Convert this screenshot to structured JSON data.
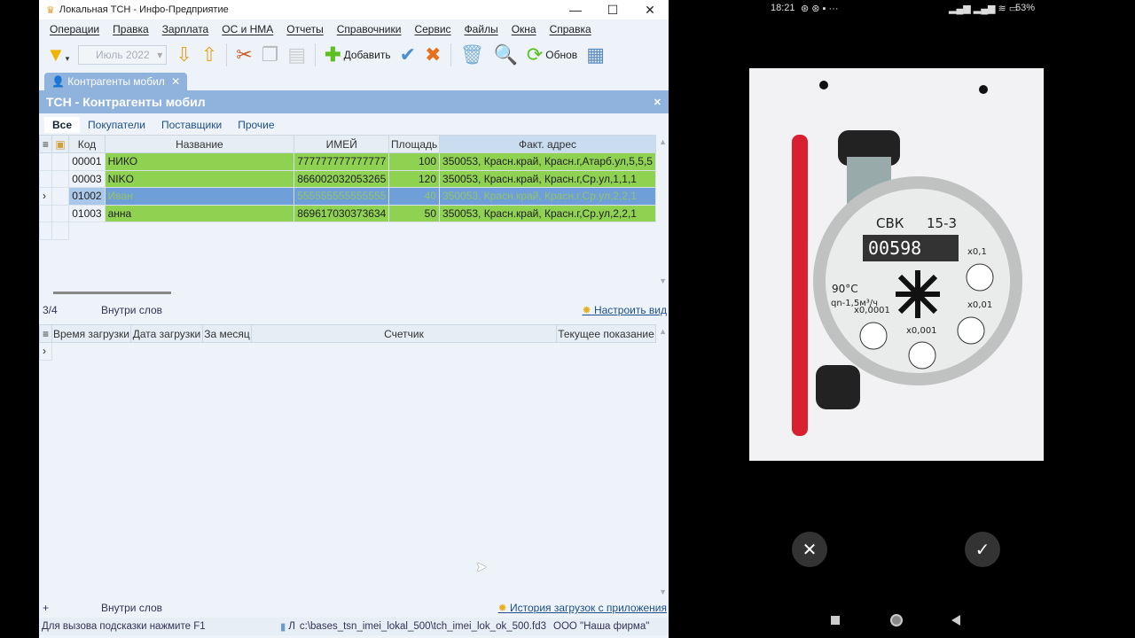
{
  "window": {
    "title": "Локальная ТСН - Инфо-Предприятие",
    "min": "—",
    "max": "☐",
    "close": "✕"
  },
  "menu": [
    "Операции",
    "Правка",
    "Зарплата",
    "ОС и НМА",
    "Отчеты",
    "Справочники",
    "Сервис",
    "Файлы",
    "Окна",
    "Справка"
  ],
  "toolbar": {
    "month": "Июль 2022",
    "add": "Добавить",
    "refresh": "Обнов"
  },
  "tab": {
    "label": "Контрагенты мобил",
    "close": "✕"
  },
  "panel": {
    "title": "ТСН - Контрагенты мобил",
    "close": "✕"
  },
  "subtabs": [
    "Все",
    "Покупатели",
    "Поставщики",
    "Прочие"
  ],
  "grid": {
    "columns": [
      "Код",
      "Название",
      "ИМЕЙ",
      "Площадь",
      "Факт. адрес"
    ],
    "rows": [
      {
        "code": "00001",
        "name": "НИКО",
        "imei": "777777777777777",
        "area": "100",
        "addr": "350053, Красн.край, Красн.г,Атарб.ул,5,5,5"
      },
      {
        "code": "00003",
        "name": "NIKO",
        "imei": "866002032053265",
        "area": "120",
        "addr": "350053, Красн.край, Красн.г,Ср.ул,1,1,1"
      },
      {
        "code": "01002",
        "name": "Иван",
        "imei": "555555555555555",
        "area": "40",
        "addr": "350053, Красн.край, Красн.г,Ср.ул,2,2,1"
      },
      {
        "code": "01003",
        "name": "анна",
        "imei": "869617030373634",
        "area": "50",
        "addr": "350053, Красн.край, Красн.г,Ср.ул,2,2,1"
      }
    ]
  },
  "status1": {
    "count": "3/4",
    "mode": "Внутри слов",
    "link": "Настроить вид"
  },
  "grid2": {
    "columns": [
      "Время загрузки",
      "Дата загрузки",
      "За месяц",
      "Счетчик",
      "Текущее показание"
    ]
  },
  "status2": {
    "plus": "+",
    "mode": "Внутри слов",
    "link": "История загрузок с приложения"
  },
  "bottom": {
    "hint": "Для вызова подсказки нажмите F1",
    "lang": "Л",
    "path": "c:\\bases_tsn_imei_lokal_500\\tch_imei_lok_ok_500.fd3",
    "firm": "ООО \"Наша фирма\""
  },
  "phone": {
    "time": "18:21",
    "battery": "53%",
    "meter_text": [
      "СВК",
      "15-3",
      "90°С",
      "qn-1,5м³/ч",
      "x0,1",
      "x0,01",
      "x0,001",
      "x0,0001"
    ],
    "cancel": "✕",
    "confirm": "✓"
  }
}
